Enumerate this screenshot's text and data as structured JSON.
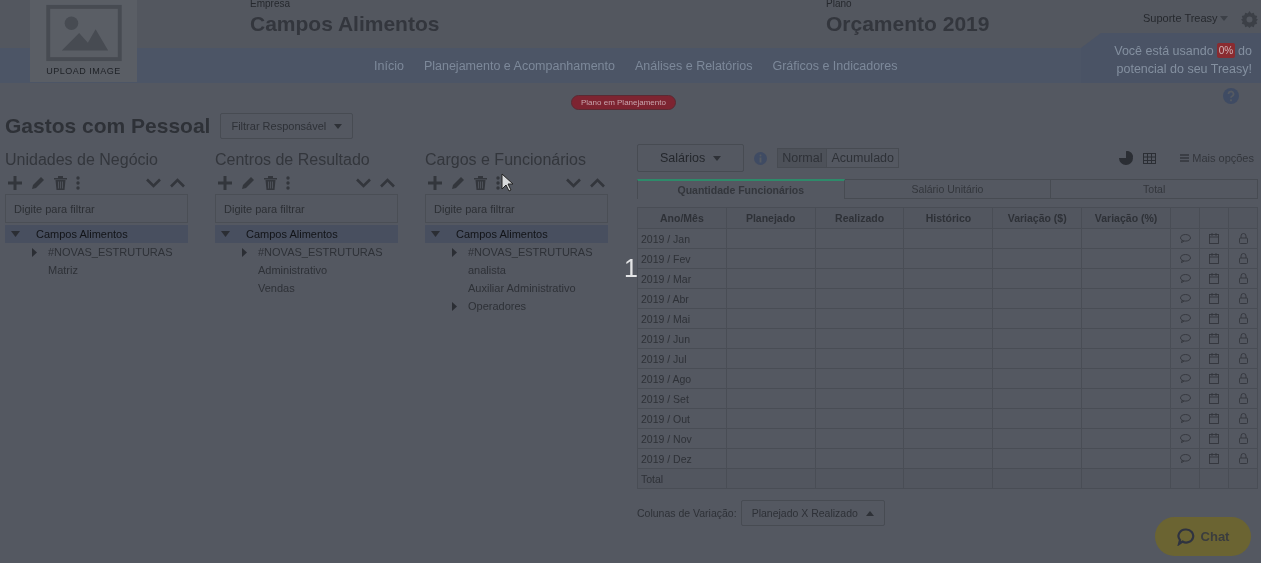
{
  "header": {
    "logo_caption": "UPLOAD IMAGE",
    "company_label": "Empresa",
    "company": "Campos Alimentos",
    "plan_label": "Plano",
    "plan": "Orçamento 2019",
    "user": "Suporte Treasy"
  },
  "nav": [
    "Início",
    "Planejamento e Acompanhamento",
    "Análises e Relatórios",
    "Gráficos e Indicadores"
  ],
  "usage": {
    "before": "Você está usando",
    "percent": "0%",
    "after": "do",
    "line2": "potencial do seu Treasy!"
  },
  "plan_status": "Plano em Planejamento",
  "page_title": "Gastos com Pessoal",
  "filter_button": "Filtrar Responsável",
  "step_number": "1",
  "trees": [
    {
      "title": "Unidades de Negócio",
      "placeholder": "Digite para filtrar",
      "root": {
        "label": "Campos Alimentos",
        "expanded": true,
        "selected": true,
        "children": [
          {
            "label": "#NOVAS_ESTRUTURAS",
            "has_children": true
          },
          {
            "label": "Matriz",
            "has_children": false
          }
        ]
      }
    },
    {
      "title": "Centros de Resultado",
      "placeholder": "Digite para filtrar",
      "root": {
        "label": "Campos Alimentos",
        "expanded": true,
        "selected": true,
        "children": [
          {
            "label": "#NOVAS_ESTRUTURAS",
            "has_children": true
          },
          {
            "label": "Administrativo",
            "has_children": false
          },
          {
            "label": "Vendas",
            "has_children": false
          }
        ]
      }
    },
    {
      "title": "Cargos e Funcionários",
      "placeholder": "Digite para filtrar",
      "root": {
        "label": "Campos Alimentos",
        "expanded": true,
        "selected": true,
        "children": [
          {
            "label": "#NOVAS_ESTRUTURAS",
            "has_children": true
          },
          {
            "label": "analista",
            "has_children": false
          },
          {
            "label": "Auxiliar Administrativo",
            "has_children": false
          },
          {
            "label": "Operadores",
            "has_children": true
          }
        ]
      }
    }
  ],
  "account_dropdown": "Salários",
  "modes": [
    {
      "label": "Normal",
      "selected": true
    },
    {
      "label": "Acumulado",
      "selected": false
    }
  ],
  "more_options": "Mais opções",
  "tabs": [
    {
      "label": "Quantidade Funcionários",
      "selected": true
    },
    {
      "label": "Salário Unitário",
      "selected": false
    },
    {
      "label": "Total",
      "selected": false
    }
  ],
  "table": {
    "columns": [
      "Ano/Mês",
      "Planejado",
      "Realizado",
      "Histórico",
      "Variação ($)",
      "Variação (%)"
    ],
    "rows": [
      "2019 / Jan",
      "2019 / Fev",
      "2019 / Mar",
      "2019 / Abr",
      "2019 / Mai",
      "2019 / Jun",
      "2019 / Jul",
      "2019 / Ago",
      "2019 / Set",
      "2019 / Out",
      "2019 / Nov",
      "2019 / Dez"
    ],
    "total_label": "Total"
  },
  "variation": {
    "label": "Colunas de Variação:",
    "value": "Planejado X Realizado"
  },
  "chat_button": "Chat"
}
